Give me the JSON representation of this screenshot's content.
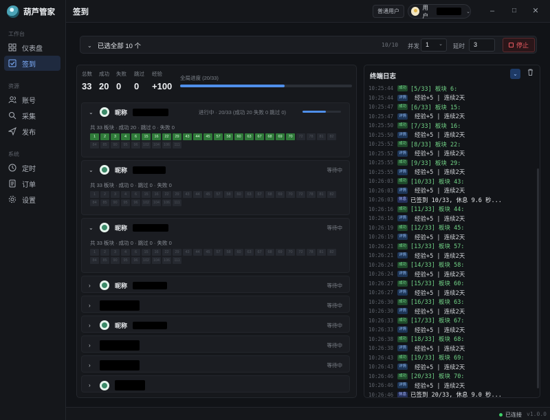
{
  "app": {
    "name": "葫芦管家",
    "version": "v1.0.0"
  },
  "nav": {
    "section_workbench": "工作台",
    "section_resources": "资源",
    "section_system": "系统",
    "items": [
      {
        "label": "仪表盘",
        "icon": "dashboard-icon"
      },
      {
        "label": "签到",
        "icon": "checkin-icon",
        "active": true
      },
      {
        "label": "账号",
        "icon": "accounts-icon"
      },
      {
        "label": "采集",
        "icon": "collect-icon"
      },
      {
        "label": "发布",
        "icon": "publish-icon"
      },
      {
        "label": "定时",
        "icon": "clock-icon"
      },
      {
        "label": "订单",
        "icon": "orders-icon"
      },
      {
        "label": "设置",
        "icon": "settings-icon"
      }
    ]
  },
  "header": {
    "title": "签到",
    "user_badge": "普通用户",
    "user_name": "用户"
  },
  "controls": {
    "select_all": "已选全部 10 个",
    "ratio": "10/10",
    "concurrency_label": "并发",
    "concurrency_value": "1",
    "delay_label": "延时",
    "delay_value": "3",
    "stop_label": "停止"
  },
  "stats": {
    "total_label": "总数",
    "total": "33",
    "success_label": "成功",
    "success": "20",
    "fail_label": "失败",
    "fail": "0",
    "skip_label": "跳过",
    "skip": "0",
    "exp_label": "经验",
    "exp": "+100",
    "progress_label": "全局进度 (20/33)",
    "progress": 0.606
  },
  "accounts": [
    {
      "name": "昵称",
      "status": "进行中 · 20/33 (成功 20 失败 0 跳过 0)",
      "progress": 0.606,
      "expanded": true,
      "summary": "共 33 板块 · 成功 20 · 跳过 0 · 失败 0"
    },
    {
      "name": "昵称",
      "status": "等待中",
      "expanded": true,
      "summary": "共 33 板块 · 成功 0 · 跳过 0 · 失败 0"
    },
    {
      "name": "昵称",
      "status": "等待中",
      "expanded": true,
      "summary": "共 33 板块 · 成功 0 · 跳过 0 · 失败 0"
    },
    {
      "name": "昵称",
      "status": "等待中",
      "expanded": false
    },
    {
      "name": "",
      "status": "等待中",
      "expanded": false
    },
    {
      "name": "昵称",
      "status": "等待中",
      "expanded": false
    },
    {
      "name": "",
      "status": "等待中",
      "expanded": false
    },
    {
      "name": "",
      "status": "等待中",
      "expanded": false
    },
    {
      "name": "",
      "status": "",
      "expanded": false
    }
  ],
  "boards_ok": [
    "1",
    "2",
    "3",
    "4",
    "6",
    "15",
    "16",
    "22",
    "29",
    "43",
    "44",
    "45",
    "57",
    "58",
    "60",
    "63",
    "67",
    "68",
    "69",
    "70"
  ],
  "boards_pending": [
    "72",
    "78",
    "81",
    "82",
    "84",
    "85",
    "90",
    "95",
    "96",
    "102",
    "104",
    "106",
    "111",
    "119",
    "132",
    "150",
    "152"
  ],
  "boards_all": [
    "1",
    "2",
    "3",
    "4",
    "6",
    "15",
    "16",
    "22",
    "29",
    "43",
    "44",
    "45",
    "57",
    "58",
    "60",
    "63",
    "67",
    "68",
    "69",
    "70",
    "72",
    "78",
    "81",
    "82",
    "84",
    "85",
    "90",
    "95",
    "96",
    "102",
    "104",
    "106",
    "111"
  ],
  "log": {
    "title": "终端日志",
    "lines": [
      {
        "time": "10:25:44",
        "tag": "成功",
        "kind": "success",
        "msg": "[5/33] 板块 6:"
      },
      {
        "time": "10:25:44",
        "tag": "详情",
        "kind": "info",
        "msg": "经验+5 | 连续2天"
      },
      {
        "time": "10:25:47",
        "tag": "成功",
        "kind": "success",
        "msg": "[6/33] 板块 15:"
      },
      {
        "time": "10:25:47",
        "tag": "详情",
        "kind": "info",
        "msg": "经验+5 | 连续2天"
      },
      {
        "time": "10:25:50",
        "tag": "成功",
        "kind": "success",
        "msg": "[7/33] 板块 16:"
      },
      {
        "time": "10:25:50",
        "tag": "详情",
        "kind": "info",
        "msg": "经验+5 | 连续2天"
      },
      {
        "time": "10:25:52",
        "tag": "成功",
        "kind": "success",
        "msg": "[8/33] 板块 22:"
      },
      {
        "time": "10:25:52",
        "tag": "详情",
        "kind": "info",
        "msg": "经验+5 | 连续2天"
      },
      {
        "time": "10:25:55",
        "tag": "成功",
        "kind": "success",
        "msg": "[9/33] 板块 29:"
      },
      {
        "time": "10:25:55",
        "tag": "详情",
        "kind": "info",
        "msg": "经验+5 | 连续2天"
      },
      {
        "time": "10:26:03",
        "tag": "成功",
        "kind": "success",
        "msg": "[10/33] 板块 43:"
      },
      {
        "time": "10:26:03",
        "tag": "详情",
        "kind": "info",
        "msg": "经验+5 | 连续2天"
      },
      {
        "time": "10:26:03",
        "tag": "休息",
        "kind": "done",
        "msg": "已签到 10/33, 休息 9.6 秒..."
      },
      {
        "time": "10:26:16",
        "tag": "成功",
        "kind": "success",
        "msg": "[11/33] 板块 44:"
      },
      {
        "time": "10:26:16",
        "tag": "详情",
        "kind": "info",
        "msg": "经验+5 | 连续2天"
      },
      {
        "time": "10:26:19",
        "tag": "成功",
        "kind": "success",
        "msg": "[12/33] 板块 45:"
      },
      {
        "time": "10:26:19",
        "tag": "详情",
        "kind": "info",
        "msg": "经验+5 | 连续2天"
      },
      {
        "time": "10:26:21",
        "tag": "成功",
        "kind": "success",
        "msg": "[13/33] 板块 57:"
      },
      {
        "time": "10:26:21",
        "tag": "详情",
        "kind": "info",
        "msg": "经验+5 | 连续2天"
      },
      {
        "time": "10:26:24",
        "tag": "成功",
        "kind": "success",
        "msg": "[14/33] 板块 58:"
      },
      {
        "time": "10:26:24",
        "tag": "详情",
        "kind": "info",
        "msg": "经验+5 | 连续2天"
      },
      {
        "time": "10:26:27",
        "tag": "成功",
        "kind": "success",
        "msg": "[15/33] 板块 60:"
      },
      {
        "time": "10:26:27",
        "tag": "详情",
        "kind": "info",
        "msg": "经验+5 | 连续2天"
      },
      {
        "time": "10:26:30",
        "tag": "成功",
        "kind": "success",
        "msg": "[16/33] 板块 63:"
      },
      {
        "time": "10:26:30",
        "tag": "详情",
        "kind": "info",
        "msg": "经验+5 | 连续2天"
      },
      {
        "time": "10:26:33",
        "tag": "成功",
        "kind": "success",
        "msg": "[17/33] 板块 67:"
      },
      {
        "time": "10:26:33",
        "tag": "详情",
        "kind": "info",
        "msg": "经验+5 | 连续2天"
      },
      {
        "time": "10:26:38",
        "tag": "成功",
        "kind": "success",
        "msg": "[18/33] 板块 68:"
      },
      {
        "time": "10:26:38",
        "tag": "详情",
        "kind": "info",
        "msg": "经验+5 | 连续2天"
      },
      {
        "time": "10:26:43",
        "tag": "成功",
        "kind": "success",
        "msg": "[19/33] 板块 69:"
      },
      {
        "time": "10:26:43",
        "tag": "详情",
        "kind": "info",
        "msg": "经验+5 | 连续2天"
      },
      {
        "time": "10:26:46",
        "tag": "成功",
        "kind": "success",
        "msg": "[20/33] 板块 70:"
      },
      {
        "time": "10:26:46",
        "tag": "详情",
        "kind": "info",
        "msg": "经验+5 | 连续2天"
      },
      {
        "time": "10:26:46",
        "tag": "休息",
        "kind": "done",
        "msg": "已签到 20/33, 休息 9.0 秒..."
      }
    ]
  },
  "footer": {
    "connection": "已连接"
  }
}
